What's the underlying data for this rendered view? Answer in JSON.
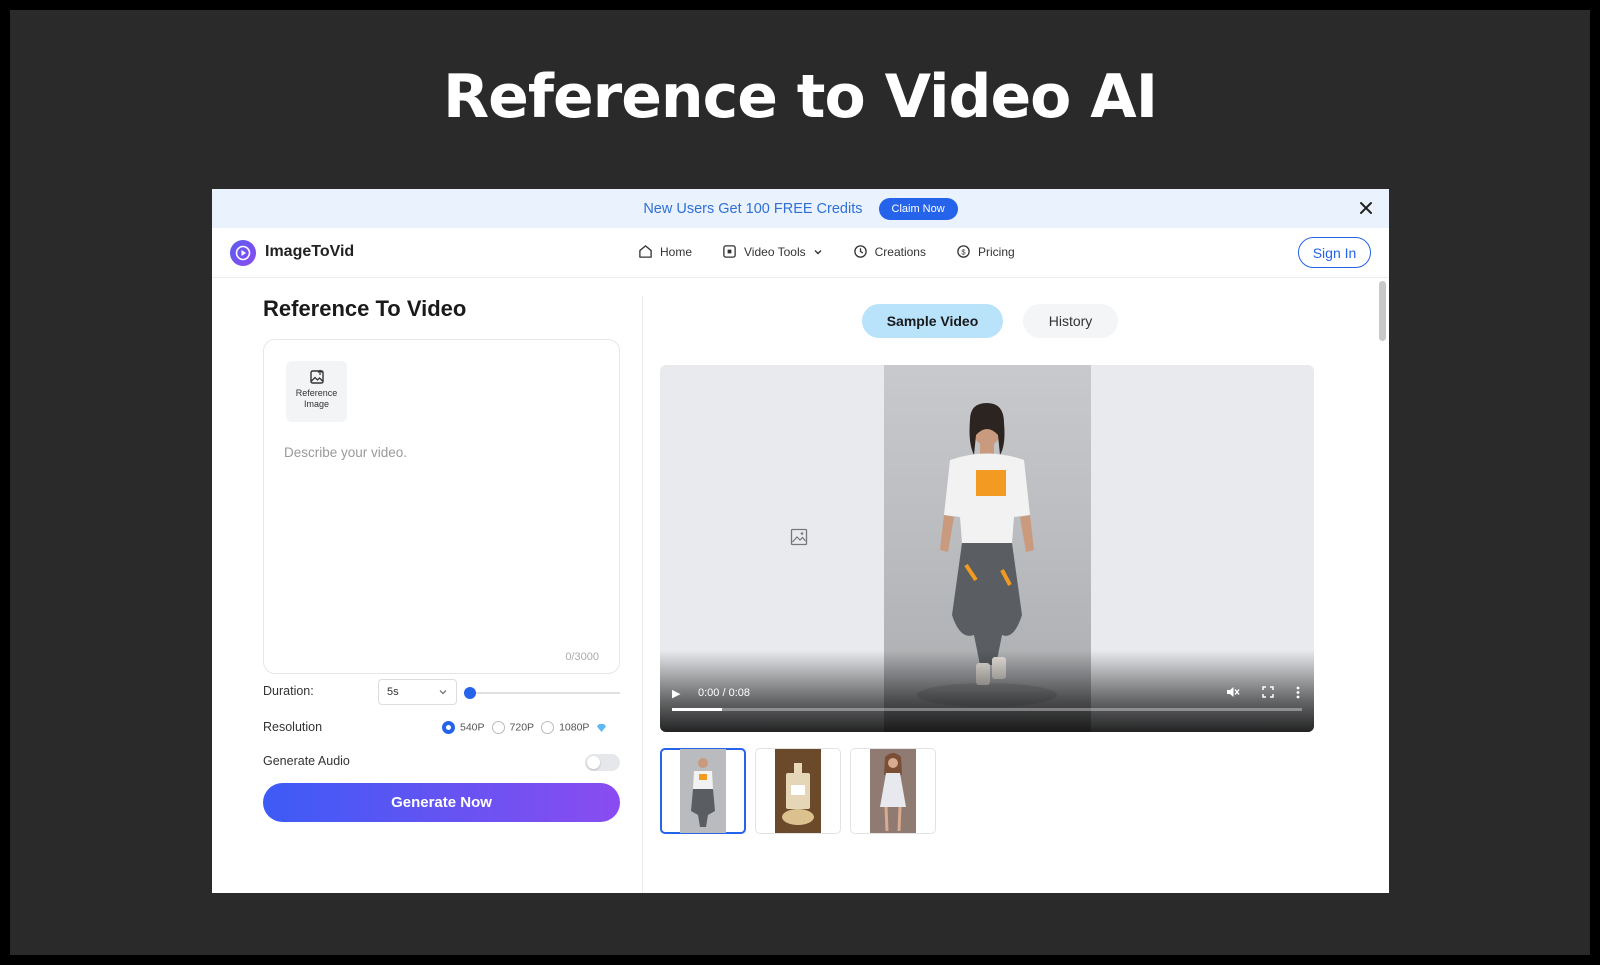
{
  "headline": "Reference to Video AI",
  "banner": {
    "text": "New Users Get 100 FREE Credits",
    "button": "Claim Now",
    "close_icon": "close-icon"
  },
  "nav": {
    "brand": "ImageToVid",
    "links": [
      {
        "label": "Home",
        "icon": "home-icon"
      },
      {
        "label": "Video Tools",
        "icon": "video-tools-icon"
      },
      {
        "label": "Creations",
        "icon": "clock-icon"
      },
      {
        "label": "Pricing",
        "icon": "pricing-icon"
      }
    ],
    "sign_in": "Sign In"
  },
  "form": {
    "title": "Reference To Video",
    "reference_label": "Reference Image",
    "prompt_placeholder": "Describe your video.",
    "counter": "0/3000",
    "duration_label": "Duration:",
    "duration_value": "5s",
    "duration_slider_fraction": 0.0,
    "resolution_label": "Resolution",
    "resolutions": [
      "540P",
      "720P",
      "1080P"
    ],
    "resolution_selected": "540P",
    "audio_label": "Generate Audio",
    "audio_enabled": false,
    "generate": "Generate Now"
  },
  "preview": {
    "tabs": [
      "Sample Video",
      "History"
    ],
    "active_tab": "Sample Video",
    "time": "0:00 / 0:08",
    "progress_fraction": 0.08,
    "thumbnails": [
      "fashion-model-thumbnail",
      "perfume-bottle-thumbnail",
      "dress-model-thumbnail"
    ]
  },
  "colors": {
    "accent": "#2563eb",
    "banner_bg": "#eaf3fd",
    "tab_active": "#b9e2fb",
    "gradient_end": "#8a4cf0"
  }
}
